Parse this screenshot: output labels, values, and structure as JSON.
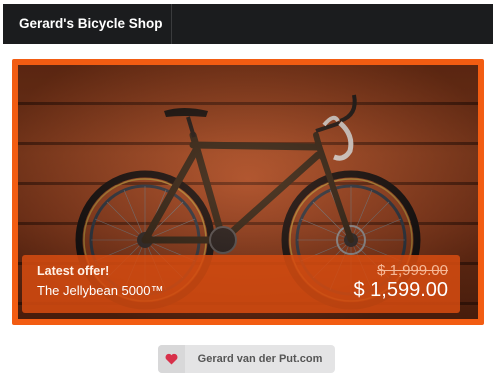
{
  "navbar": {
    "brand": "Gerard's Bicycle Shop"
  },
  "offer": {
    "label": "Latest offer!",
    "product": "The Jellybean 5000™",
    "old_price": "$ 1,999.00",
    "new_price": "$ 1,599.00"
  },
  "footer": {
    "link_text": "Gerard van der Put.com",
    "icon": "heart-icon"
  },
  "colors": {
    "accent": "#f25c12",
    "navbar": "#1b1c1e",
    "heart": "#d8304a"
  }
}
